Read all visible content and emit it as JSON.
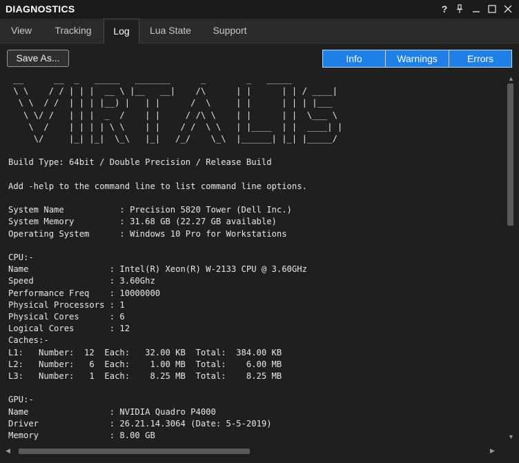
{
  "window": {
    "title": "DIAGNOSTICS",
    "controls": [
      {
        "name": "help-icon",
        "glyph": "?"
      },
      {
        "name": "pin-icon",
        "glyph": "pin"
      },
      {
        "name": "minimize-icon",
        "glyph": "minimize"
      },
      {
        "name": "maximize-icon",
        "glyph": "maximize"
      },
      {
        "name": "close-icon",
        "glyph": "close"
      }
    ]
  },
  "tabs": [
    {
      "label": "View",
      "active": false
    },
    {
      "label": "Tracking",
      "active": false
    },
    {
      "label": "Log",
      "active": true
    },
    {
      "label": "Lua State",
      "active": false
    },
    {
      "label": "Support",
      "active": false
    }
  ],
  "toolbar": {
    "save_label": "Save As...",
    "filters": [
      "Info",
      "Warnings",
      "Errors"
    ],
    "filter_color": "#1e7fe6"
  },
  "log": {
    "lines": [
      " __      __  _   _____   _______      _        _   _____",
      " \\ \\    / / | | |  __ \\ |__   __|    /\\      | |      | | / ____|",
      "  \\ \\  / /  | | | |__) |   | |      /  \\     | |      | | | |___",
      "   \\ \\/ /   | | |  _  /    | |     / /\\ \\    | |      | |  \\___ \\",
      "    \\  /    | | | | \\ \\    | |    / /  \\ \\   | |____  | |  ____| |",
      "     \\/     |_| |_|  \\_\\   |_|   /_/    \\_\\  |______| |_| |_____/",
      "",
      "Build Type: 64bit / Double Precision / Release Build",
      "",
      "Add -help to the command line to list command line options.",
      "",
      "System Name           : Precision 5820 Tower (Dell Inc.)",
      "System Memory         : 31.68 GB (22.27 GB available)",
      "Operating System      : Windows 10 Pro for Workstations",
      "",
      "CPU:-",
      "Name                : Intel(R) Xeon(R) W-2133 CPU @ 3.60GHz",
      "Speed               : 3.60Ghz",
      "Performance Freq    : 10000000",
      "Physical Processors : 1",
      "Physical Cores      : 6",
      "Logical Cores       : 12",
      "Caches:-",
      "L1:   Number:  12  Each:   32.00 KB  Total:  384.00 KB",
      "L2:   Number:   6  Each:    1.00 MB  Total:    6.00 MB",
      "L3:   Number:   1  Each:    8.25 MB  Total:    8.25 MB",
      "",
      "GPU:-",
      "Name                : NVIDIA Quadro P4000",
      "Driver              : 26.21.14.3064 (Date: 5-5-2019)",
      "Memory              : 8.00 GB"
    ]
  },
  "scrollbars": {
    "vertical_position": 0.0,
    "horizontal_position": 0.0
  }
}
